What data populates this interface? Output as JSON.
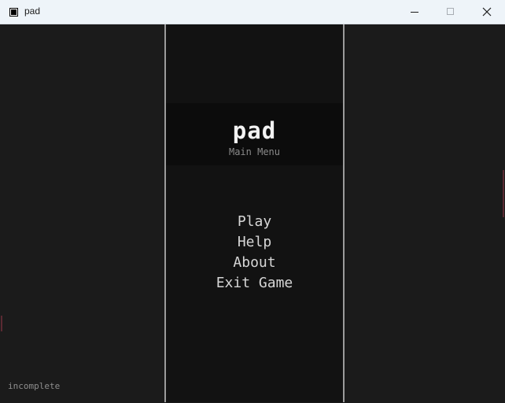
{
  "window": {
    "title": "pad",
    "icons": {
      "app": "app-icon",
      "minimize": "minimize-icon",
      "maximize": "maximize-icon",
      "close": "close-icon"
    }
  },
  "game": {
    "title": "pad",
    "subtitle": "Main Menu",
    "menu": {
      "play": "Play",
      "help": "Help",
      "about": "About",
      "exit": "Exit Game"
    },
    "status": "incomplete"
  },
  "colors": {
    "background": "#1b1b1b",
    "center_column": "#121212",
    "title_band": "#0c0c0c",
    "divider": "#9b9b9b",
    "menu_text": "#d6d6d6",
    "title_text": "#f2f2f2",
    "subtitle_text": "#8a8a8a",
    "titlebar": "#eef4f9"
  }
}
